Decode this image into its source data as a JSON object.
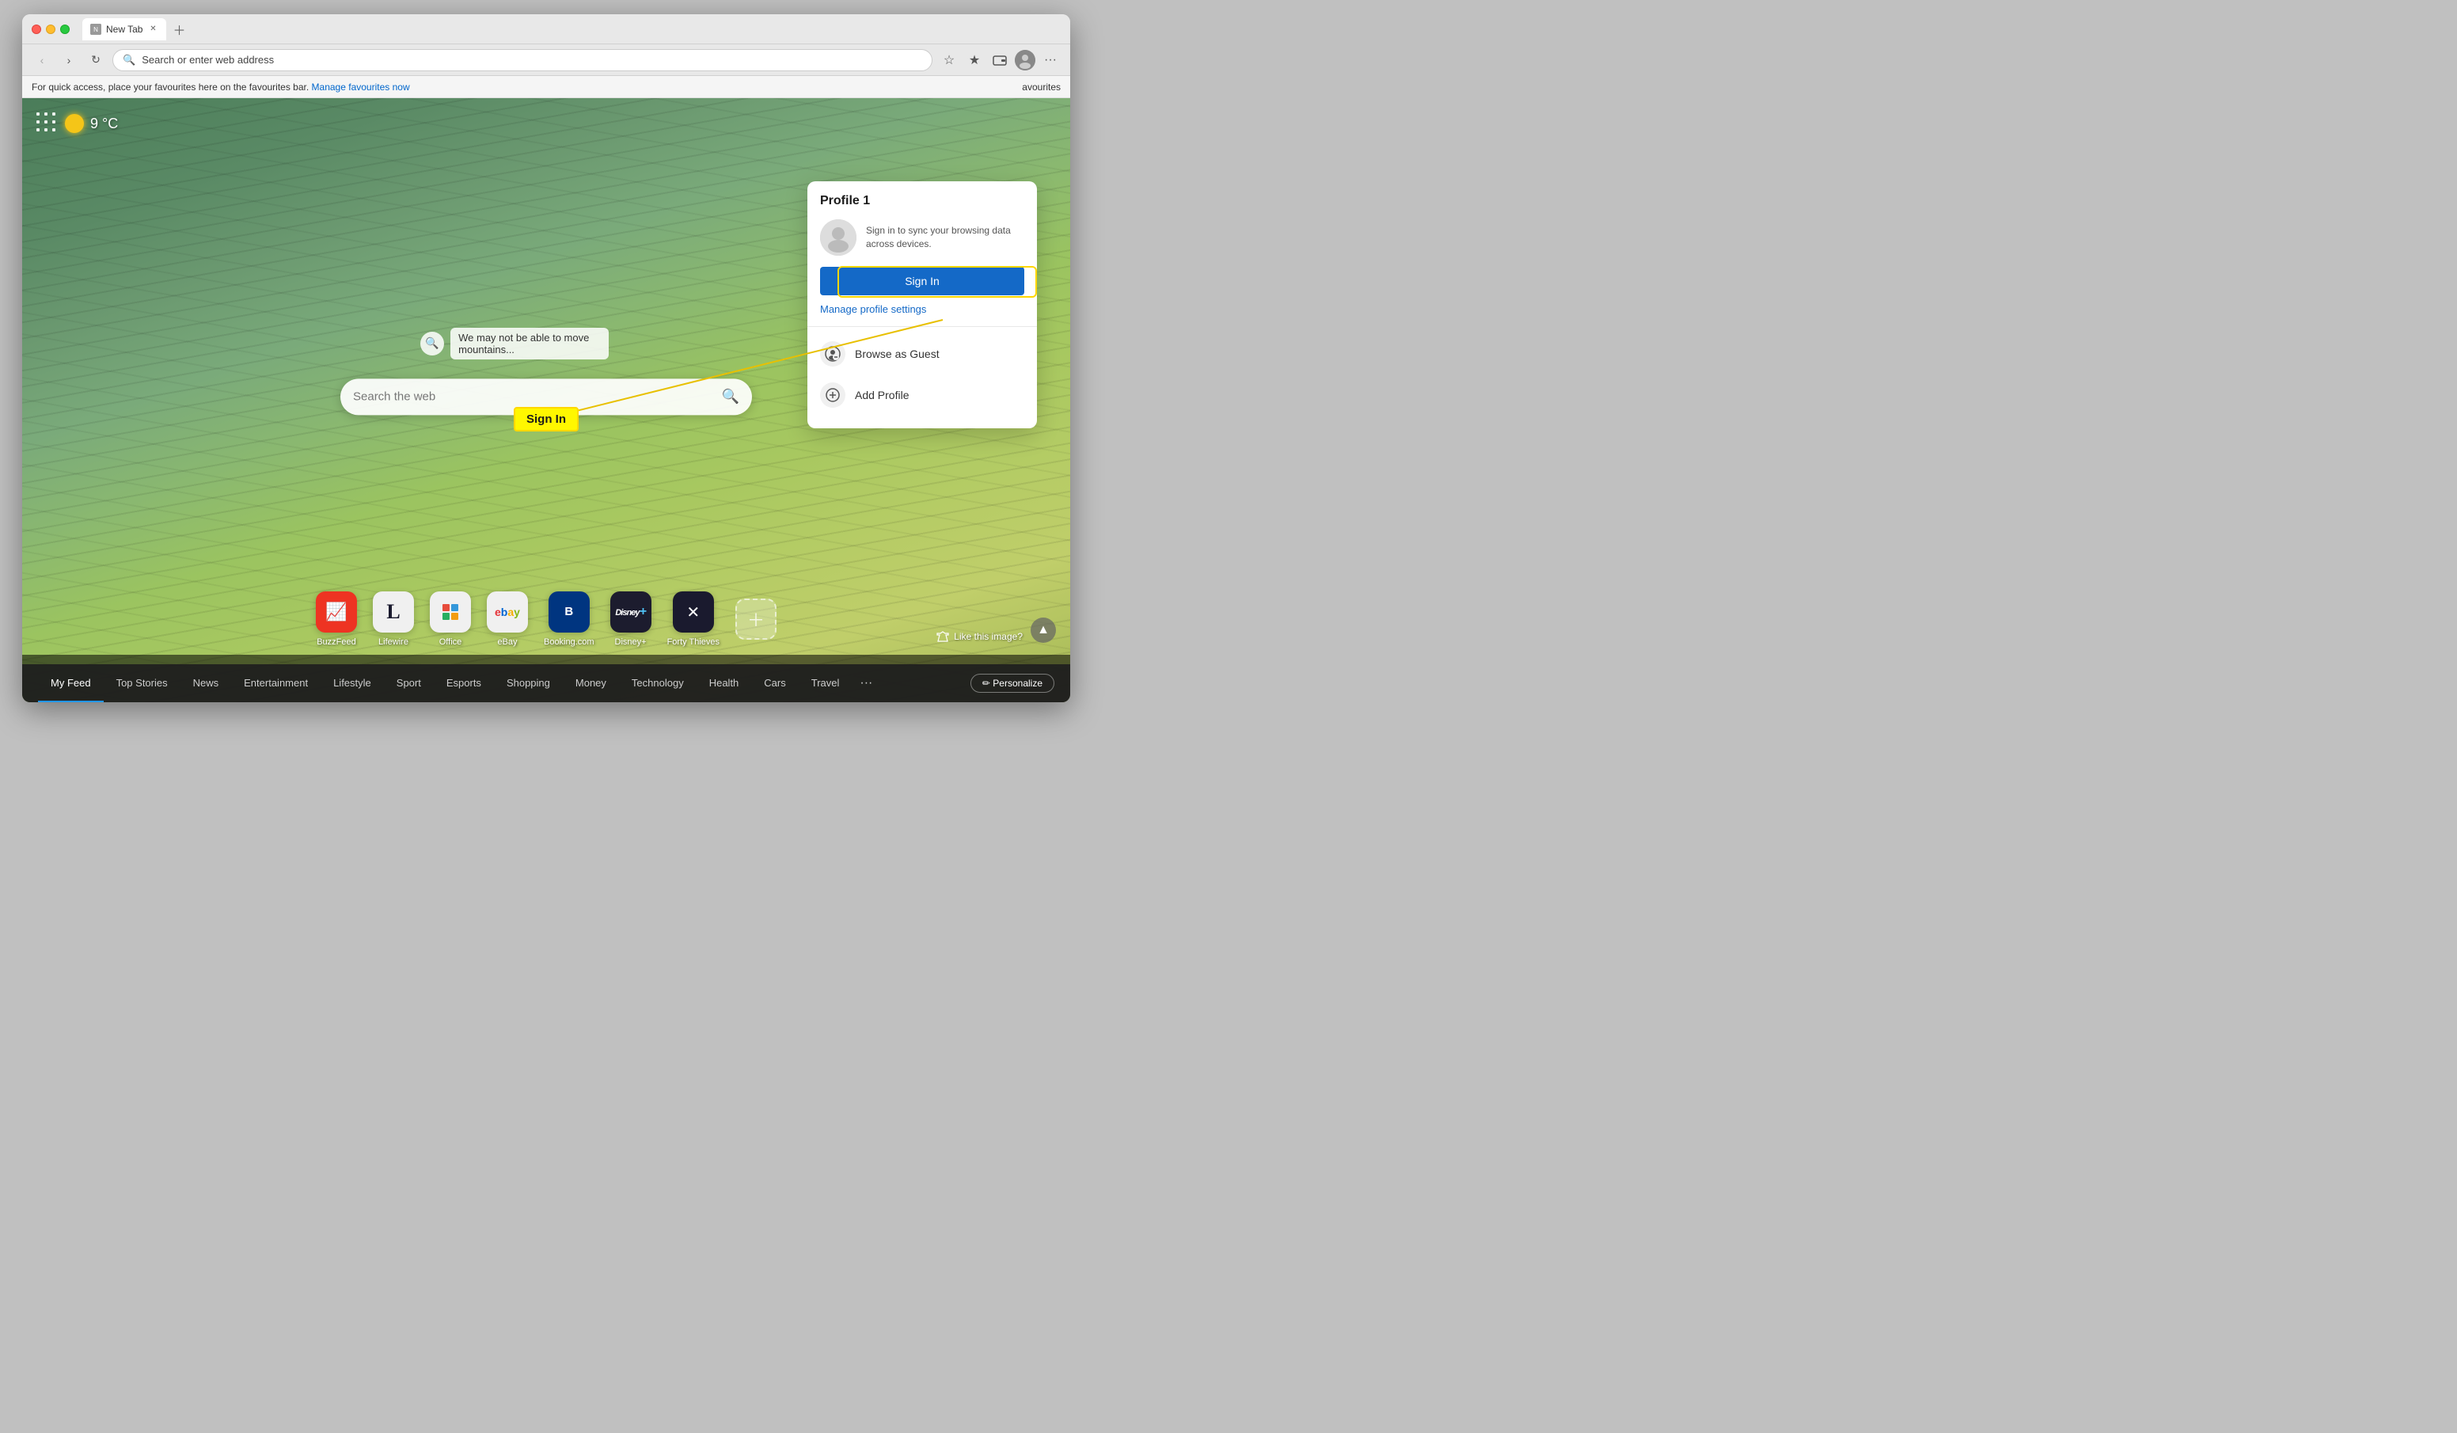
{
  "browser": {
    "tab_title": "New Tab",
    "address_placeholder": "Search or enter web address",
    "address_value": ""
  },
  "favourites_bar": {
    "text": "For quick access, place your favourites here on the favourites bar.",
    "link_text": "Manage favourites now"
  },
  "weather": {
    "temperature": "9 °C"
  },
  "search": {
    "placeholder": "Search the web"
  },
  "quote": {
    "text": "We may not be able to move mountains..."
  },
  "quick_links": [
    {
      "label": "BuzzFeed",
      "icon_type": "buzzfeed"
    },
    {
      "label": "Lifewire",
      "icon_type": "lifewire"
    },
    {
      "label": "Office",
      "icon_type": "office"
    },
    {
      "label": "eBay",
      "icon_type": "ebay"
    },
    {
      "label": "Booking.com",
      "icon_type": "booking"
    },
    {
      "label": "Disney+",
      "icon_type": "disney"
    },
    {
      "label": "Forty Thieves",
      "icon_type": "fortythieves"
    }
  ],
  "bottom_nav": {
    "items": [
      {
        "label": "My Feed",
        "active": true
      },
      {
        "label": "Top Stories",
        "active": false
      },
      {
        "label": "News",
        "active": false
      },
      {
        "label": "Entertainment",
        "active": false
      },
      {
        "label": "Lifestyle",
        "active": false
      },
      {
        "label": "Sport",
        "active": false
      },
      {
        "label": "Esports",
        "active": false
      },
      {
        "label": "Shopping",
        "active": false
      },
      {
        "label": "Money",
        "active": false
      },
      {
        "label": "Technology",
        "active": false
      },
      {
        "label": "Health",
        "active": false
      },
      {
        "label": "Cars",
        "active": false
      },
      {
        "label": "Travel",
        "active": false
      }
    ],
    "personalize_label": "✏ Personalize"
  },
  "profile_dropdown": {
    "title": "Profile 1",
    "sync_text": "Sign in to sync your browsing data across devices.",
    "sign_in_label": "Sign In",
    "manage_label": "Manage profile settings",
    "browse_guest_label": "Browse as Guest",
    "add_profile_label": "Add Profile"
  },
  "like_image": {
    "label": "Like this image?"
  },
  "annotation": {
    "label": "Sign In"
  }
}
